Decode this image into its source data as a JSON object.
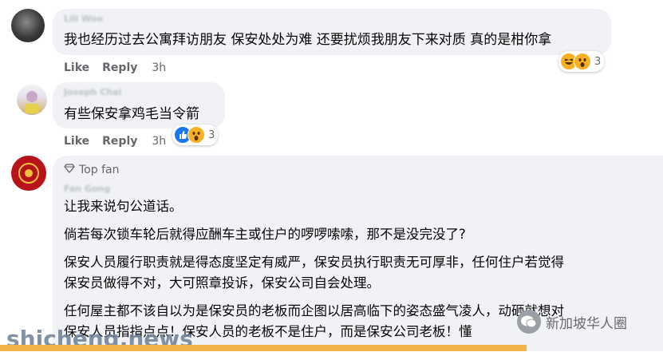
{
  "comments": [
    {
      "author": "Lili Woo",
      "text": "我也经历过去公寓拜访朋友 保安处处为难 还要扰烦我朋友下来对质 真的是柑你拿",
      "like_label": "Like",
      "reply_label": "Reply",
      "time": "3h",
      "reaction_count": "3"
    },
    {
      "author": "Joseph Chai",
      "text": "有些保安拿鸡毛当令箭",
      "like_label": "Like",
      "reply_label": "Reply",
      "time": "3h",
      "reaction_count": "3"
    },
    {
      "badge": "Top fan",
      "author": "Fan Gong",
      "paragraphs": [
        "让我来说句公道话。",
        "倘若每次锁车轮后就得应酬车主或住户的啰啰嗦嗦，那不是没完没了?",
        "保安人员履行职责就是得态度坚定有威严，保安员执行职责无可厚非，任何住户若觉得",
        "保安员做得不对，大可照章投诉，保安公司自会处理。",
        "任何屋主都不该自以为是保安员的老板而企图以居高临下的姿态盛气凌人，动砸就想对",
        "保安人员指指点点！保安人员的老板不是住户，而是保安公司老板！懂"
      ]
    }
  ],
  "watermark": {
    "left": "shicheng.news",
    "right": "新加坡华人圈"
  },
  "colors": {
    "bubble": "#f0f2f5",
    "action_text": "#65676b",
    "like_blue": "#1877f2",
    "reaction_yellow": "#f7b125",
    "bottom_bar": "#f4b24a"
  },
  "icons": {
    "top_fan": "diamond-icon",
    "haha": "haha-reaction-icon",
    "wow": "wow-reaction-icon",
    "like": "like-reaction-icon"
  }
}
